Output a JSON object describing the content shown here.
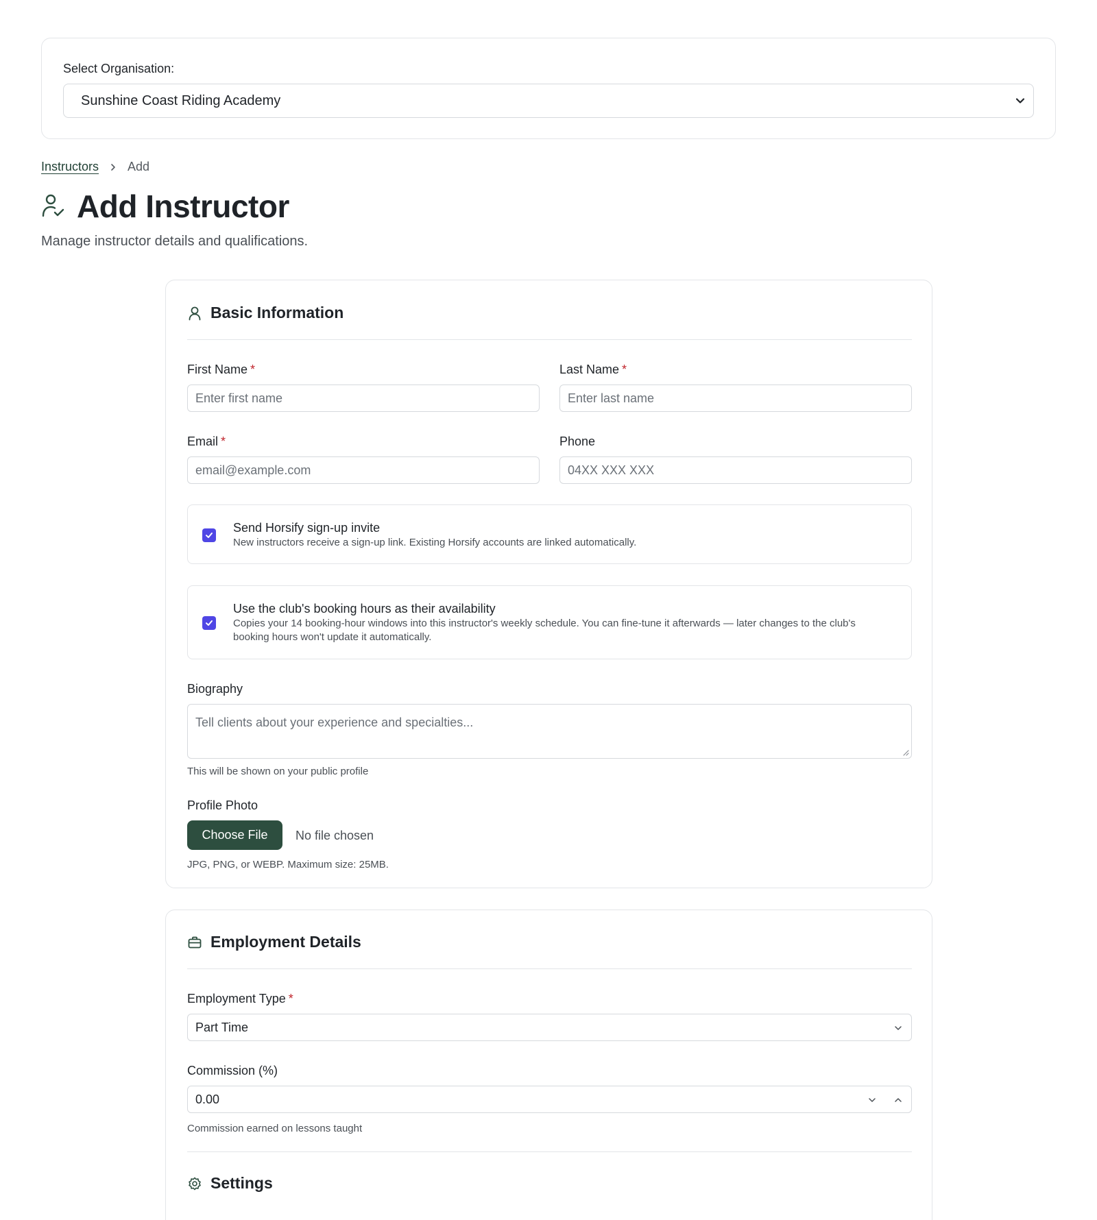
{
  "organisation": {
    "label": "Select Organisation:",
    "selected": "Sunshine Coast Riding Academy"
  },
  "breadcrumb": {
    "parent": "Instructors",
    "current": "Add"
  },
  "header": {
    "title": "Add Instructor",
    "subtitle": "Manage instructor details and qualifications.",
    "icon": "user-check-icon"
  },
  "basic_info": {
    "title": "Basic Information",
    "icon": "user-icon",
    "first_name": {
      "label": "First Name",
      "required": "*",
      "placeholder": "Enter first name"
    },
    "last_name": {
      "label": "Last Name",
      "required": "*",
      "placeholder": "Enter last name"
    },
    "email": {
      "label": "Email",
      "required": "*",
      "placeholder": "email@example.com"
    },
    "phone": {
      "label": "Phone",
      "placeholder": "04XX XXX XXX"
    },
    "invite": {
      "title": "Send Horsify sign-up invite",
      "description": "New instructors receive a sign-up link. Existing Horsify accounts are linked automatically.",
      "checked": true
    },
    "availability": {
      "title": "Use the club's booking hours as their availability",
      "description": "Copies your 14 booking-hour windows into this instructor's weekly schedule. You can fine-tune it afterwards — later changes to the club's booking hours won't update it automatically.",
      "checked": true
    },
    "biography": {
      "label": "Biography",
      "placeholder": "Tell clients about your experience and specialties...",
      "hint": "This will be shown on your public profile"
    },
    "photo": {
      "label": "Profile Photo",
      "button": "Choose File",
      "status": "No file chosen",
      "hint": "JPG, PNG, or WEBP. Maximum size: 25MB."
    }
  },
  "employment": {
    "title": "Employment Details",
    "icon": "briefcase-icon",
    "type": {
      "label": "Employment Type",
      "required": "*",
      "selected": "Part Time"
    },
    "commission": {
      "label": "Commission (%)",
      "value": "0.00",
      "hint": "Commission earned on lessons taught"
    }
  },
  "settings": {
    "title": "Settings",
    "icon": "gear-icon"
  },
  "colors": {
    "brand": "#2d4e3f",
    "checkbox": "#4f46e5",
    "required": "#c0262d"
  }
}
